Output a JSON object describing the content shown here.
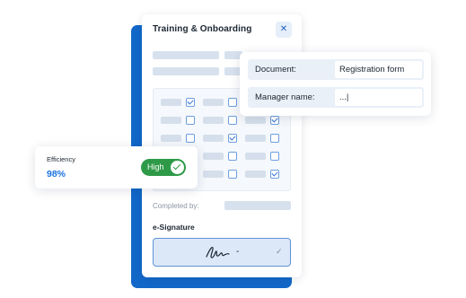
{
  "panel": {
    "title": "Training & Onboarding",
    "close_icon": "close-icon",
    "completed_label": "Completed by:",
    "esignature_label": "e-Signature",
    "signature_dash": "-",
    "signature_check_icon": "check-icon",
    "checklist": [
      [
        true,
        false,
        true
      ],
      [
        false,
        false,
        true
      ],
      [
        false,
        true,
        false
      ],
      [
        false,
        false,
        false
      ],
      [
        false,
        false,
        true
      ]
    ]
  },
  "document_card": {
    "document_label": "Document:",
    "document_value": "Registration form",
    "manager_label": "Manager name:",
    "manager_value": "...|"
  },
  "efficiency_card": {
    "label": "Efficiency",
    "value": "98%",
    "toggle_label": "High",
    "toggle_on": true
  },
  "colors": {
    "brand_blue": "#1268c9",
    "accent_blue": "#1a73e0",
    "toggle_green": "#2e9a48"
  }
}
